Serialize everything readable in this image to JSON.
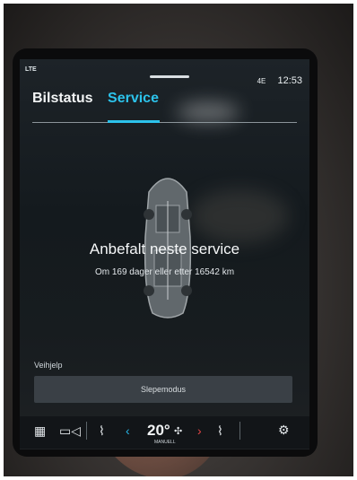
{
  "status": {
    "left": "LTE",
    "network": "4E",
    "time": "12:53"
  },
  "tabs": [
    {
      "label": "Bilstatus",
      "active": false
    },
    {
      "label": "Service",
      "active": true
    }
  ],
  "service": {
    "title": "Anbefalt neste service",
    "subtitle": "Om 169 dager eller etter 16542 km"
  },
  "assistance": {
    "section_label": "Veihjelp",
    "button_label": "Slepemodus"
  },
  "bottom_bar": {
    "temperature": "20°",
    "mode": "MANUELL",
    "icons": [
      "grid-icon",
      "camera-icon",
      "seat-heat-icon",
      "fan-icon",
      "seat-icon",
      "settings-icon"
    ]
  },
  "colors": {
    "accent": "#2cc3ec",
    "arrow_left": "#27b7e8",
    "arrow_right": "#e54545",
    "background": "#171c1f"
  }
}
